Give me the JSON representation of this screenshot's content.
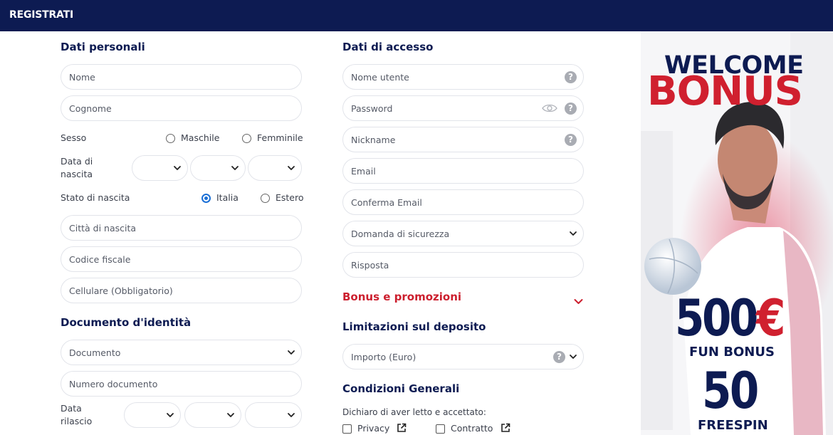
{
  "header": {
    "title": "REGISTRATI"
  },
  "personal": {
    "title": "Dati personali",
    "nome": "Nome",
    "cognome": "Cognome",
    "sesso_label": "Sesso",
    "sesso_options": [
      "Maschile",
      "Femminile"
    ],
    "nascita_label_1": "Data di",
    "nascita_label_2": "nascita",
    "stato_label": "Stato di nascita",
    "stato_options": [
      "Italia",
      "Estero"
    ],
    "stato_selected": "Italia",
    "citta": "Città di nascita",
    "codice": "Codice fiscale",
    "cellulare": "Cellulare (Obbligatorio)"
  },
  "document": {
    "title": "Documento d'identità",
    "documento": "Documento",
    "numero": "Numero documento",
    "rilascio_label_1": "Data",
    "rilascio_label_2": "rilascio"
  },
  "access": {
    "title": "Dati di accesso",
    "nome_utente": "Nome utente",
    "password": "Password",
    "nickname": "Nickname",
    "email": "Email",
    "conferma": "Conferma Email",
    "domanda": "Domanda di sicurezza",
    "risposta": "Risposta"
  },
  "bonus": {
    "title": "Bonus e promozioni"
  },
  "limits": {
    "title": "Limitazioni sul deposito",
    "importo": "Importo (Euro)"
  },
  "conditions": {
    "title": "Condizioni Generali",
    "dichiaro": "Dichiaro di aver letto e accettato:",
    "privacy": "Privacy",
    "contratto": "Contratto"
  },
  "promo": {
    "welcome": "WELCOME",
    "bonus": "BONUS",
    "amount": "500",
    "currency": "€",
    "fun_bonus": "FUN BONUS",
    "freespin_count": "50",
    "freespin": "FREESPIN"
  },
  "colors": {
    "navy": "#0d1b52",
    "red": "#d0202f",
    "radio_blue": "#1a6fd6"
  },
  "icons": [
    "help-icon",
    "eye-icon",
    "chevron-down-icon",
    "external-link-icon"
  ]
}
